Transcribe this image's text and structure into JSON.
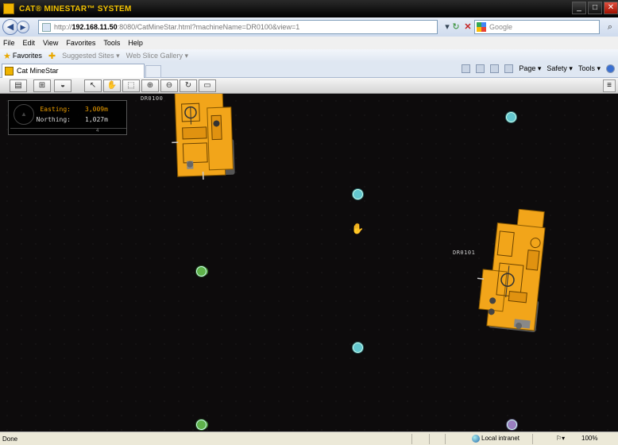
{
  "window": {
    "title": "CAT® MINESTAR™ SYSTEM",
    "controls": [
      "_",
      "□",
      "✕"
    ]
  },
  "address_bar": {
    "url_prefix": "http://",
    "url_host": "192.168.11.50",
    "url_path": ":8080/CatMineStar.html?machineName=DR0100&view=1",
    "search_placeholder": "Google"
  },
  "menu": [
    "File",
    "Edit",
    "View",
    "Favorites",
    "Tools",
    "Help"
  ],
  "favorites_bar": {
    "label": "Favorites",
    "items": [
      "Suggested Sites ▾",
      "Web Slice Gallery ▾"
    ]
  },
  "tabs": [
    {
      "label": "Cat MineStar"
    }
  ],
  "command_bar": [
    "Page ▾",
    "Safety ▾",
    "Tools ▾"
  ],
  "toolbar_icons": [
    "document-icon",
    "grid-icon",
    "layers-icon",
    "pointer-icon",
    "hand-icon",
    "zoom-box-icon",
    "zoom-in-icon",
    "zoom-out-icon",
    "refresh-icon",
    "ruler-icon"
  ],
  "coordinates": {
    "easting_label": "Easting:",
    "easting_value": "3,009m",
    "northing_label": "Northing:",
    "northing_value": "1,027m",
    "strip_value": "4"
  },
  "machines": [
    {
      "name": "DR0100",
      "color": "#f2a51a"
    },
    {
      "name": "DR0101",
      "color": "#f2a51a"
    }
  ],
  "markers": [
    {
      "type": "cyan"
    },
    {
      "type": "cyan"
    },
    {
      "type": "green"
    },
    {
      "type": "cyan"
    },
    {
      "type": "green"
    },
    {
      "type": "purple"
    }
  ],
  "status": {
    "left": "Done",
    "zone": "Local intranet",
    "zoom": "100%"
  }
}
